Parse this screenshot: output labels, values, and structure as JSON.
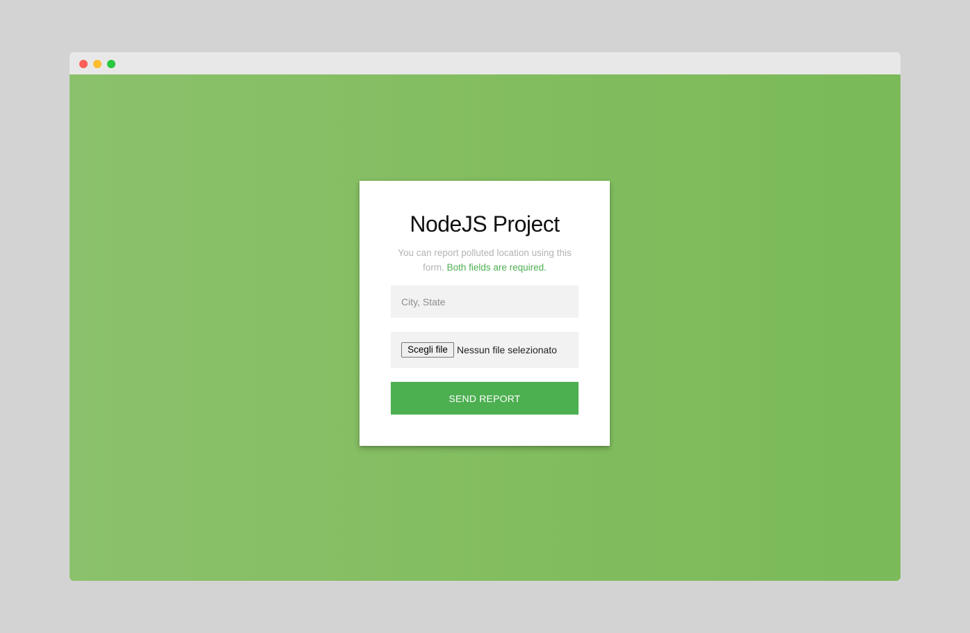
{
  "window": {
    "controls": [
      "close",
      "minimize",
      "maximize"
    ]
  },
  "form": {
    "title": "NodeJS Project",
    "description_text": "You can report polluted location using this form.",
    "description_required": "Both fields are required.",
    "location_input": {
      "value": "",
      "placeholder": "City, State"
    },
    "file_input": {
      "button_label": "Scegli file",
      "status_text": "Nessun file selezionato"
    },
    "submit_label": "SEND REPORT"
  },
  "colors": {
    "accent": "#4caf50",
    "background_gradient": [
      "#8bc16c",
      "#7aba58"
    ],
    "card": "#ffffff",
    "input_bg": "#f2f2f2"
  }
}
